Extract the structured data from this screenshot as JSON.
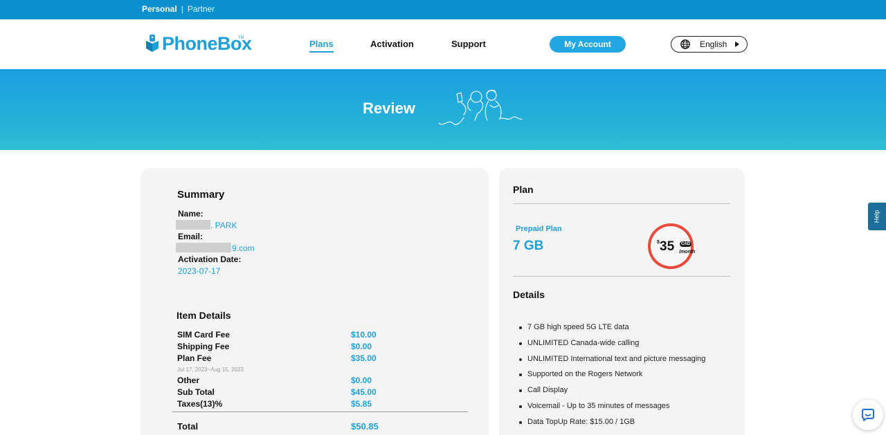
{
  "topbar": {
    "personal": "Personal",
    "separator": "|",
    "partner": "Partner"
  },
  "header": {
    "logo_text": "PhoneBox",
    "logo_tm": "TM",
    "nav": {
      "plans": "Plans",
      "activation": "Activation",
      "support": "Support"
    },
    "account_button": "My Account",
    "language": "English"
  },
  "hero": {
    "title": "Review"
  },
  "summary": {
    "heading": "Summary",
    "name_label": "Name:",
    "name_value": ". PARK",
    "email_label": "Email:",
    "email_value": "9.com",
    "activation_label": "Activation Date:",
    "activation_value": "2023-07-17"
  },
  "items": {
    "heading": "Item Details",
    "rows": [
      {
        "label": "SIM Card Fee",
        "value": "$10.00"
      },
      {
        "label": "Shipping Fee",
        "value": "$0.00"
      },
      {
        "label": "Plan Fee",
        "value": "$35.00"
      },
      {
        "label": "Other",
        "value": "$0.00"
      },
      {
        "label": "Sub Total",
        "value": "$45.00"
      },
      {
        "label": "Taxes(13)%",
        "value": "$5.85"
      }
    ],
    "plan_period": "Jul 17, 2023~Aug 15, 2023",
    "total_label": "Total",
    "total_value": "$50.85"
  },
  "plan": {
    "heading": "Plan",
    "type": "Prepaid Plan",
    "size": "7 GB",
    "price_dollar": "$",
    "price_amount": "35",
    "price_currency": "CAD",
    "price_period": "/month",
    "details_heading": "Details",
    "details": [
      "7 GB high speed 5G LTE data",
      "UNLIMITED Canada-wide calling",
      "UNLIMITED International text and picture messaging",
      "Supported on the Rogers Network",
      "Call Display",
      "Voicemail - Up to 35 minutes of messages",
      "Data TopUp Rate: $15.00 / 1GB"
    ]
  },
  "help": {
    "label": "Help"
  },
  "colors": {
    "brand_blue": "#1e9fd8",
    "top_bar": "#0a8fcf",
    "badge_red": "#e94a3a"
  }
}
